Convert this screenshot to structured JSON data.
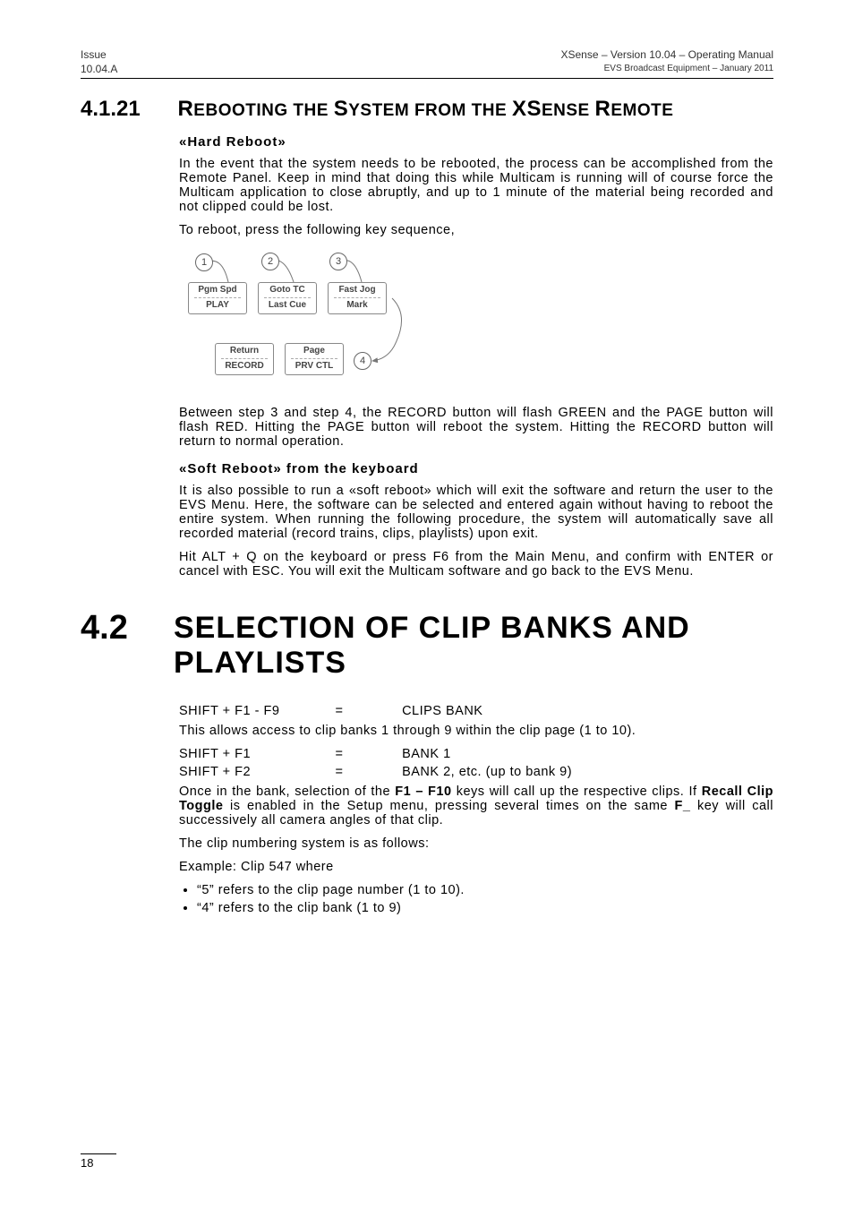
{
  "header": {
    "left_line1": "Issue",
    "left_line2": "10.04.A",
    "right_line1": "XSense – Version 10.04 – Operating Manual",
    "right_line2": "EVS Broadcast Equipment  – January 2011"
  },
  "sec_a": {
    "num": "4.1.21",
    "title_parts": {
      "w1": "R",
      "w1s": "EBOOTING THE ",
      "w2": "S",
      "w2s": "YSTEM FROM THE ",
      "w3": "XS",
      "w3s": "ENSE ",
      "w4": "R",
      "w4s": "EMOTE"
    },
    "h_hard": "«Hard Reboot»",
    "p1": "In the event that the system needs to be rebooted, the process can be accomplished from the Remote Panel. Keep in mind that doing this while Multicam is running will of course force the Multicam application to close abruptly, and up to 1 minute of the material being recorded and not clipped could be lost.",
    "p2": "To reboot, press the following key sequence,",
    "keys": {
      "k1": {
        "top": "Pgm Spd",
        "bot": "PLAY"
      },
      "k2": {
        "top": "Goto TC",
        "bot": "Last Cue"
      },
      "k3": {
        "top": "Fast Jog",
        "bot": "Mark"
      },
      "k4": {
        "top": "Return",
        "bot": "RECORD"
      },
      "k5": {
        "top": "Page",
        "bot": "PRV CTL"
      }
    },
    "step_labels": {
      "s1": "1",
      "s2": "2",
      "s3": "3",
      "s4": "4"
    },
    "p3": "Between step 3 and step 4, the RECORD button will flash GREEN and the PAGE button will flash RED. Hitting the PAGE button will reboot the system. Hitting the RECORD button will return to normal operation.",
    "h_soft": "«Soft Reboot» from the keyboard",
    "p4": "It is also possible to run a «soft reboot» which will exit the software and return the user to the EVS Menu. Here, the software can be selected and entered again without having to reboot the entire system. When running the following procedure, the system will automatically save all recorded material (record trains, clips, playlists) upon exit.",
    "p5": "Hit ALT + Q on the keyboard or press F6 from the Main Menu, and confirm with ENTER or cancel with ESC. You will exit the Multicam software and go back to the EVS Menu."
  },
  "sec_b": {
    "num": "4.2",
    "title": "SELECTION OF CLIP BANKS AND PLAYLISTS",
    "kb1": {
      "c1": "SHIFT  +  F1  - F9",
      "c2": "=",
      "c3": "CLIPS BANK"
    },
    "p1": "This allows access to clip banks 1 through 9 within the clip page (1 to 10).",
    "kb2": {
      "c1": "SHIFT + F1",
      "c2": "=",
      "c3": "BANK 1"
    },
    "kb3": {
      "c1": "SHIFT  + F2",
      "c2": "=",
      "c3": "BANK 2, etc. (up to bank 9)"
    },
    "p2a": "Once in the bank, selection of the ",
    "p2b": "F1 – F10",
    "p2c": " keys will call up the respective clips. If ",
    "p2d": "Recall Clip Toggle",
    "p2e": " is enabled in the Setup menu, pressing several times on the same ",
    "p2f": "F_",
    "p2g": " key will call successively all camera angles of that clip.",
    "p3": "The clip numbering system is as follows:",
    "p4": "Example: Clip 547 where",
    "b1": "“5” refers to the clip page number (1 to 10).",
    "b2": "“4” refers to the clip bank (1 to 9)"
  },
  "footer": {
    "page": "18"
  }
}
